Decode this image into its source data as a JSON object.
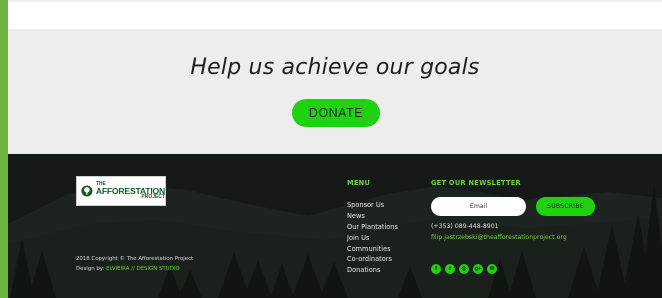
{
  "goals": {
    "title": "Help us achieve our goals",
    "donate_label": "DONATE"
  },
  "footer": {
    "logo": {
      "line1": "THE",
      "line2": "AFFORESTATION",
      "line3": "PROJECT"
    },
    "copyright": "2018 Copyright © The Afforestation Project",
    "credit_prefix": "Design by:",
    "credit_studio": "ELVIEIRA // DESIGN STUDIO",
    "menu": {
      "heading": "MENU",
      "items": [
        "Sponsor Us",
        "News",
        "Our Plantations",
        "Join Us",
        "Communities",
        "Co-ordinators",
        "Donations"
      ]
    },
    "newsletter": {
      "heading": "GET OUR NEWSLETTER",
      "email_placeholder": "Email",
      "subscribe_label": "SUBSCRIBE",
      "phone": "(+353) 089-448-8901",
      "email": "filip.jastrzebski@theafforestationproject.org"
    },
    "socials": [
      {
        "icon": "facebook-icon",
        "glyph": "f"
      },
      {
        "icon": "twitter-icon",
        "glyph": "t"
      },
      {
        "icon": "instagram-icon",
        "glyph": "◎"
      },
      {
        "icon": "google-plus-icon",
        "glyph": "g+"
      },
      {
        "icon": "email-icon",
        "glyph": "✉"
      }
    ]
  },
  "colors": {
    "accent_green": "#1fd10e",
    "link_green": "#6fd13b",
    "footer_bg": "#161a17",
    "section_bg": "#ededed",
    "left_bar": "#6fb43f"
  }
}
